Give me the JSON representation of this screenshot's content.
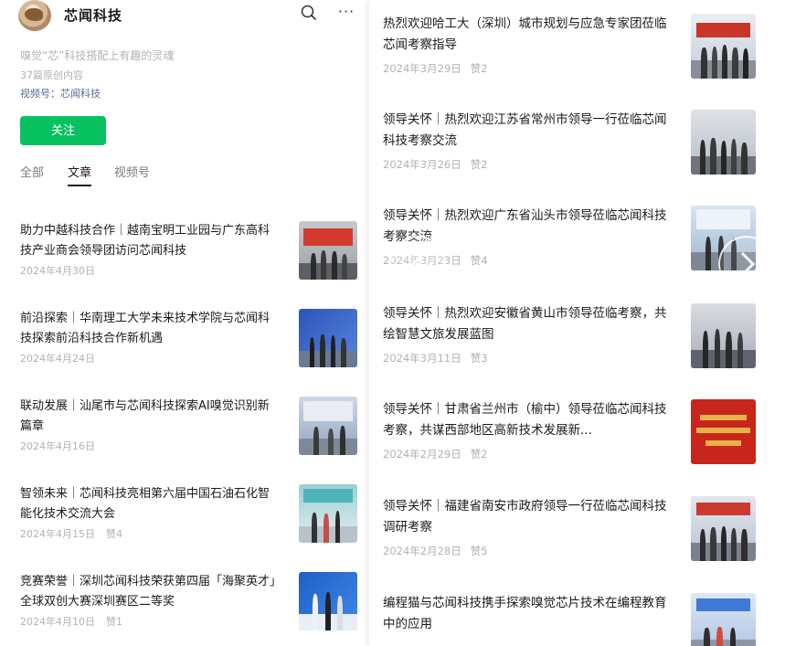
{
  "account": {
    "name": "芯闻科技",
    "signature": "嗅觉“芯”科技搭配上有趣的灵魂",
    "content_count": "37篇原创内容",
    "channel": "视频号：芯闻科技",
    "follow_label": "关注"
  },
  "tabs": [
    {
      "label": "全部",
      "active": false
    },
    {
      "label": "文章",
      "active": true
    },
    {
      "label": "视频号",
      "active": false
    }
  ],
  "left_articles": [
    {
      "title": "助力中越科技合作｜越南宝明工业园与广东高科技产业商会领导团访问芯闻科技",
      "date": "2024年4月30日",
      "likes": ""
    },
    {
      "title": "前沿探索｜华南理工大学未来技术学院与芯闻科技探索前沿科技合作新机遇",
      "date": "2024年4月24日",
      "likes": ""
    },
    {
      "title": "联动发展｜汕尾市与芯闻科技探索AI嗅觉识别新篇章",
      "date": "2024年4月16日",
      "likes": ""
    },
    {
      "title": "智领未来｜芯闻科技亮相第六届中国石油石化智能化技术交流大会",
      "date": "2024年4月15日",
      "likes": "赞4"
    },
    {
      "title": "竞赛荣誉｜深圳芯闻科技荣获第四届「海聚英才」全球双创大赛深圳赛区二等奖",
      "date": "2024年4月10日",
      "likes": "赞1"
    }
  ],
  "right_articles": [
    {
      "title": "热烈欢迎哈工大（深圳）城市规划与应急专家团莅临芯闻考察指导",
      "date": "2024年3月29日",
      "likes": "赞2"
    },
    {
      "title": "领导关怀｜热烈欢迎江苏省常州市领导一行莅临芯闻科技考察交流",
      "date": "2024年3月26日",
      "likes": "赞2"
    },
    {
      "title": "领导关怀｜热烈欢迎广东省汕头市领导莅临芯闻科技考察交流",
      "date": "2024年3月23日",
      "likes": "赞4"
    },
    {
      "title": "领导关怀｜热烈欢迎安徽省黄山市领导莅临考察，共绘智慧文旅发展蓝图",
      "date": "2024年3月11日",
      "likes": "赞3"
    },
    {
      "title": "领导关怀｜甘肃省兰州市（榆中）领导莅临芯闻科技考察，共谋西部地区高新技术发展新...",
      "date": "2024年2月29日",
      "likes": "赞2"
    },
    {
      "title": "领导关怀｜福建省南安市政府领导一行莅临芯闻科技调研考察",
      "date": "2024年2月28日",
      "likes": "赞5"
    },
    {
      "title": "编程猫与芯闻科技携手探索嗅觉芯片技术在编程教育中的应用",
      "date": "",
      "likes": ""
    }
  ],
  "colors": {
    "accent_green": "#07c160",
    "link_blue": "#576b95",
    "meta_gray": "#b2b2b2"
  },
  "icons": [
    "logo-avatar",
    "search-icon",
    "more-icon",
    "chevron-left-icon",
    "chevron-right-icon"
  ]
}
